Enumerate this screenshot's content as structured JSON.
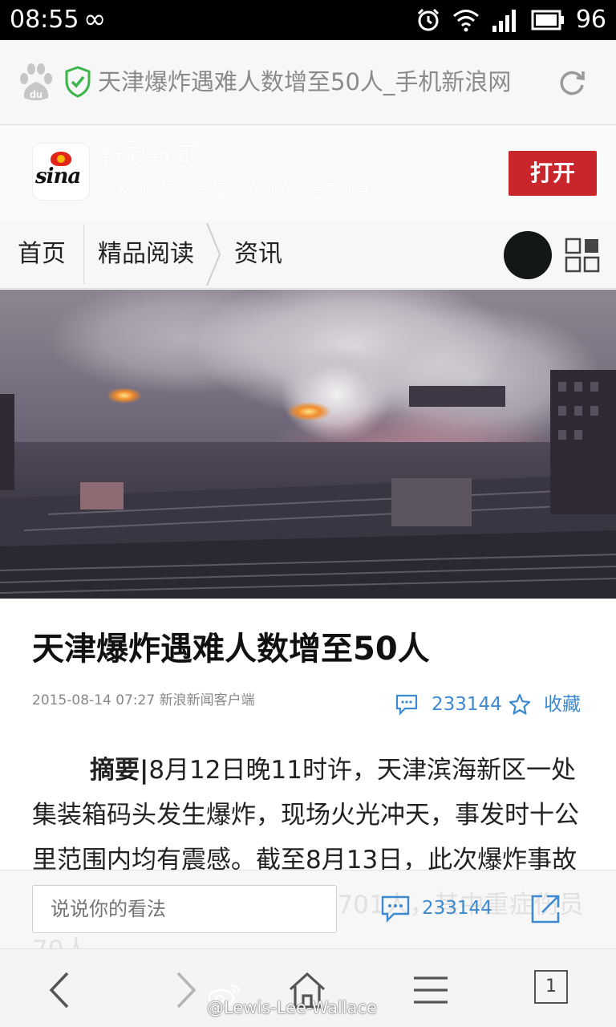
{
  "status_bar": {
    "time": "08:55",
    "infinity_symbol": "∞",
    "battery_level": "96",
    "icons": [
      "alarm-icon",
      "wifi-icon",
      "signal-icon",
      "battery-icon"
    ]
  },
  "browser": {
    "page_title": "天津爆炸遇难人数增至50人_手机新浪网",
    "icons": [
      "baidu-icon",
      "secure-shield-icon",
      "refresh-icon"
    ]
  },
  "app_banner": {
    "app_name": "新浪新闻",
    "tagline": "突发时刻尽在掌握，随时随地查看新闻",
    "open_label": "打开",
    "logo_text": "sina"
  },
  "breadcrumb": {
    "items": [
      "首页",
      "精品阅读",
      "资讯"
    ]
  },
  "article": {
    "title": "天津爆炸遇难人数增至50人",
    "meta": "2015-08-14 07:27 新浪新闻客户端",
    "comment_count": "233144",
    "favorite_label": "收藏",
    "lead_label": "摘要|",
    "body_text": "8月12日晚11时许，天津滨海新区一处集装箱码头发生爆炸，现场火光冲天，事发时十公里范围内均有震感。截至8月13日，此次爆炸事故共造成50人死亡，住院治疗701人，其中重症伤员70人。"
  },
  "comment_bar": {
    "placeholder": "说说你的看法",
    "comment_count": "233144"
  },
  "browser_nav": {
    "tab_count": "1",
    "icons": [
      "back-icon",
      "forward-icon",
      "home-icon",
      "menu-icon",
      "tabs-icon"
    ]
  },
  "watermark": {
    "text": "@Lewis-Lee-Wallace"
  },
  "colors": {
    "accent_red": "#c9262b",
    "link_blue": "#3d8ad0",
    "secure_green": "#3bb54a"
  }
}
